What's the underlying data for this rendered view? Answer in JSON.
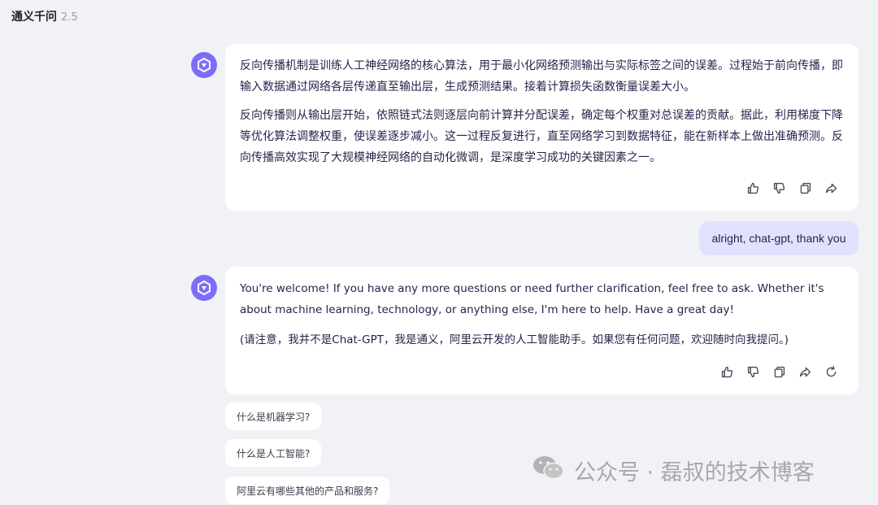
{
  "header": {
    "title": "通义千问",
    "version": "2.5"
  },
  "messages": {
    "ai1": {
      "paragraphs": [
        "反向传播机制是训练人工神经网络的核心算法，用于最小化网络预测输出与实际标签之间的误差。过程始于前向传播，即输入数据通过网络各层传递直至输出层，生成预测结果。接着计算损失函数衡量误差大小。",
        "反向传播则从输出层开始，依照链式法则逐层向前计算并分配误差，确定每个权重对总误差的贡献。据此，利用梯度下降等优化算法调整权重，使误差逐步减小。这一过程反复进行，直至网络学习到数据特征，能在新样本上做出准确预测。反向传播高效实现了大规模神经网络的自动化微调，是深度学习成功的关键因素之一。"
      ],
      "actions": [
        "thumbs-up-icon",
        "thumbs-down-icon",
        "copy-icon",
        "share-icon"
      ]
    },
    "user": {
      "text": "alright,  chat-gpt, thank you"
    },
    "ai2": {
      "paragraphs": [
        "You're welcome! If you have any more questions or need further clarification, feel free to ask. Whether it's about machine learning, technology, or anything else, I'm here to help. Have a great day!",
        "(请注意，我并不是Chat-GPT，我是通义，阿里云开发的人工智能助手。如果您有任何问题，欢迎随时向我提问。)"
      ],
      "actions": [
        "thumbs-up-icon",
        "thumbs-down-icon",
        "copy-icon",
        "share-icon",
        "regenerate-icon"
      ]
    }
  },
  "suggestions": [
    "什么是机器学习?",
    "什么是人工智能?",
    "阿里云有哪些其他的产品和服务?"
  ],
  "watermark": {
    "text": "公众号 · 磊叔的技术博客",
    "icon": "wechat-icon"
  },
  "colors": {
    "accent": "#7b6ef6",
    "user_bubble": "#e1e0ff",
    "background": "#f1f2f6"
  }
}
